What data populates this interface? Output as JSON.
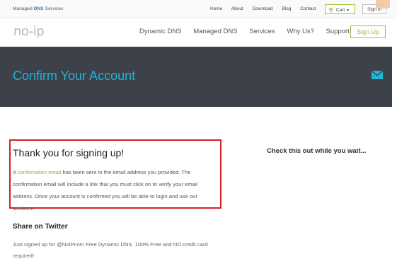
{
  "topbar": {
    "brand_prefix": "Managed",
    "brand_dns": "DNS",
    "brand_suffix": "Services",
    "links": [
      "Home",
      "About",
      "Download",
      "Blog",
      "Contact"
    ],
    "cart_label": "Cart",
    "signin_label": "Sign In"
  },
  "nav": {
    "logo_left": "no",
    "logo_dot": "-",
    "logo_right": "ip",
    "links": [
      "Dynamic DNS",
      "Managed DNS",
      "Services",
      "Why Us?",
      "Support"
    ],
    "signup_label": "Sign Up"
  },
  "hero": {
    "title": "Confirm Your Account"
  },
  "main": {
    "heading": "Thank you for signing up!",
    "text_before": "A ",
    "link_text": "confirmation email",
    "text_after": " has been sent to the email address you provided. The confirmation email will include a link that you must click on to verify your email address. Once your account is confirmed you will be able to login and use our services."
  },
  "share": {
    "title": "Share on Twitter",
    "tweet": "Just signed up for @NoIPcom Free Dynamic DNS. 100% Free and NO credit card required!"
  },
  "sidebar": {
    "title": "Check this out while you wait..."
  },
  "colors": {
    "accent_green": "#8cc63f",
    "hero_bg": "#3c414a",
    "hero_title": "#1fb4d8",
    "highlight_border": "#d32027"
  },
  "icons": {
    "cart": "cart-icon",
    "mail": "mail-icon",
    "dropdown": "chevron-down-icon"
  }
}
